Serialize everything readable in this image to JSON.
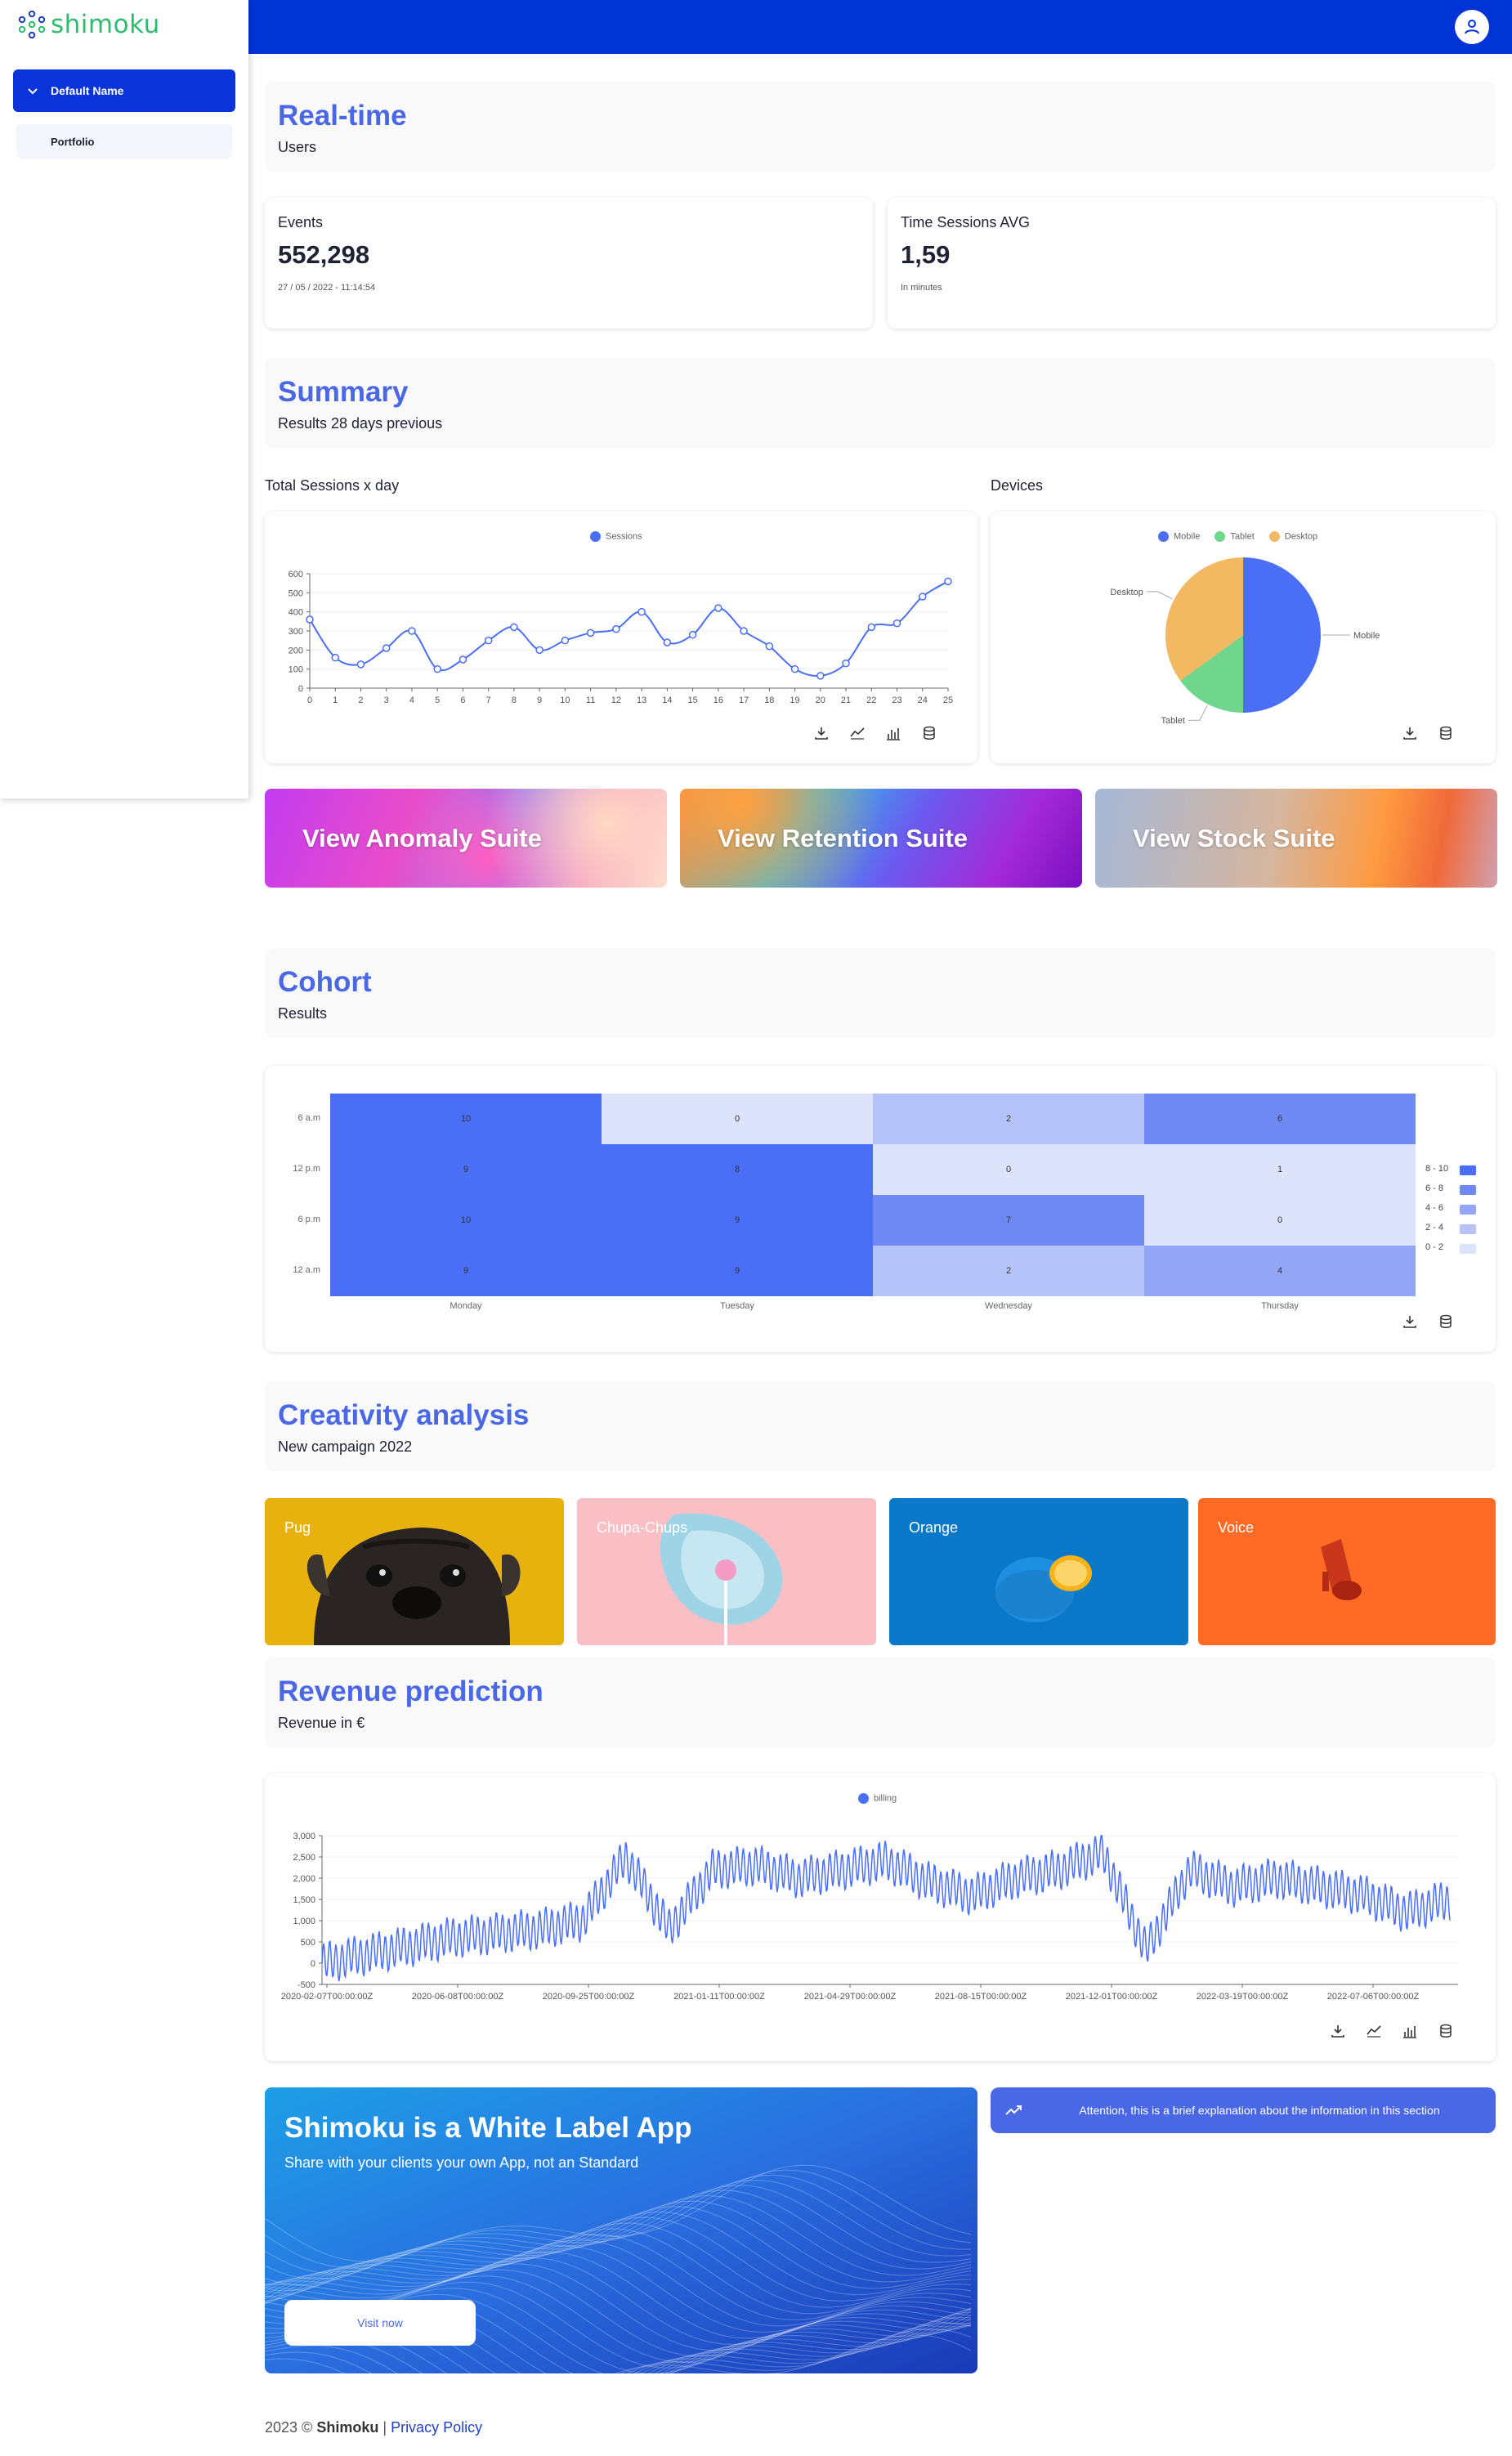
{
  "brand": {
    "name": "shimoku",
    "logo_color": "#2dbd6e"
  },
  "colors": {
    "primary": "#0033d6",
    "accent": "#4a68e6"
  },
  "sidebar": {
    "group_label": "Default Name",
    "items": [
      {
        "label": "Portfolio"
      }
    ]
  },
  "header": {
    "avatar_icon": "user-icon"
  },
  "realtime": {
    "title": "Real-time",
    "subtitle": "Users",
    "indicators": [
      {
        "title": "Events",
        "value": "552,298",
        "footer": "27 / 05 / 2022 - 11:14:54"
      },
      {
        "title": "Time Sessions AVG",
        "value": "1,59",
        "footer": "In minutes"
      }
    ]
  },
  "summary": {
    "title": "Summary",
    "subtitle": "Results 28 days previous",
    "sessions_label": "Total Sessions x day",
    "devices_label": "Devices"
  },
  "chart_data": [
    {
      "type": "line",
      "legend": [
        "Sessions"
      ],
      "x": [
        0,
        1,
        2,
        3,
        4,
        5,
        6,
        7,
        8,
        9,
        10,
        11,
        12,
        13,
        14,
        15,
        16,
        17,
        18,
        19,
        20,
        21,
        22,
        23,
        24,
        25
      ],
      "series": [
        {
          "name": "Sessions",
          "values": [
            360,
            160,
            125,
            210,
            300,
            100,
            150,
            250,
            320,
            200,
            250,
            290,
            310,
            400,
            240,
            280,
            420,
            300,
            220,
            100,
            65,
            130,
            320,
            340,
            480,
            560
          ]
        }
      ],
      "yticks": [
        0,
        100,
        200,
        300,
        400,
        500,
        600
      ],
      "ylim": [
        0,
        600
      ],
      "grid": true,
      "legend_position": "top"
    },
    {
      "type": "pie",
      "legend": [
        "Mobile",
        "Tablet",
        "Desktop"
      ],
      "categories": [
        "Mobile",
        "Tablet",
        "Desktop"
      ],
      "values": [
        50,
        15,
        35
      ],
      "colors": [
        "#4a6ef5",
        "#6fd68c",
        "#f2b862"
      ],
      "legend_position": "top"
    },
    {
      "type": "heatmap",
      "x": [
        "Monday",
        "Tuesday",
        "Wednesday",
        "Thursday"
      ],
      "y": [
        "6 a.m",
        "12 p.m",
        "6 p.m",
        "12 a.m"
      ],
      "values": [
        [
          10,
          0,
          2,
          6
        ],
        [
          9,
          8,
          0,
          1
        ],
        [
          10,
          9,
          7,
          0
        ],
        [
          9,
          9,
          2,
          4
        ]
      ],
      "legend_ranges": [
        "8 - 10",
        "6 - 8",
        "4 - 6",
        "2 - 4",
        "0 - 2"
      ],
      "legend_colors": [
        "#4a6ef5",
        "#6f89f3",
        "#93a6f5",
        "#b6c3f8",
        "#dde3fb"
      ]
    },
    {
      "type": "line",
      "legend": [
        "billing"
      ],
      "x_ticks": [
        "2020-02-07T00:00:00Z",
        "2020-06-08T00:00:00Z",
        "2020-09-25T00:00:00Z",
        "2021-01-11T00:00:00Z",
        "2021-04-29T00:00:00Z",
        "2021-08-15T00:00:00Z",
        "2021-12-01T00:00:00Z",
        "2022-03-19T00:00:00Z",
        "2022-07-06T00:00:00Z"
      ],
      "yticks": [
        -500,
        0,
        500,
        1000,
        1500,
        2000,
        2500,
        3000
      ],
      "ylim": [
        -500,
        3000
      ],
      "series": [
        {
          "name": "billing",
          "x_start": "2020-02-07",
          "x_end": "2022-09-30",
          "approx_trend": [
            0,
            200,
            400,
            600,
            700,
            800,
            1000,
            2500,
            800,
            2200,
            2300,
            2000,
            2200,
            2400,
            1900,
            1600,
            2000,
            2200,
            2600,
            300,
            2200,
            1800,
            2000,
            1800,
            1600,
            1200,
            1500
          ]
        }
      ],
      "grid": true,
      "legend_position": "top"
    }
  ],
  "toolbar_icons": [
    "download-icon",
    "line-chart-icon",
    "bar-chart-icon",
    "database-icon"
  ],
  "suites": [
    {
      "label": "View Anomaly Suite"
    },
    {
      "label": "View Retention Suite"
    },
    {
      "label": "View Stock Suite"
    }
  ],
  "cohort": {
    "title": "Cohort",
    "subtitle": "Results"
  },
  "creativity": {
    "title": "Creativity analysis",
    "subtitle": "New campaign 2022",
    "tiles": [
      {
        "label": "Pug",
        "bg": "#e8b20e"
      },
      {
        "label": "Chupa-Chups",
        "bg": "#f9bfc4"
      },
      {
        "label": "Orange",
        "bg": "#0a78c8"
      },
      {
        "label": "Voice",
        "bg": "#ff6a24"
      }
    ]
  },
  "revenue": {
    "title": "Revenue prediction",
    "subtitle": "Revenue in €"
  },
  "banner": {
    "title": "Shimoku is a White Label App",
    "subtitle": "Share with your clients your own App, not an Standard",
    "button": "Visit now"
  },
  "notice": {
    "text": "Attention, this is a brief explanation about the information in this section"
  },
  "footer": {
    "prefix": "2023 ©",
    "brand": "Shimoku",
    "separator": "|",
    "link": "Privacy Policy"
  }
}
